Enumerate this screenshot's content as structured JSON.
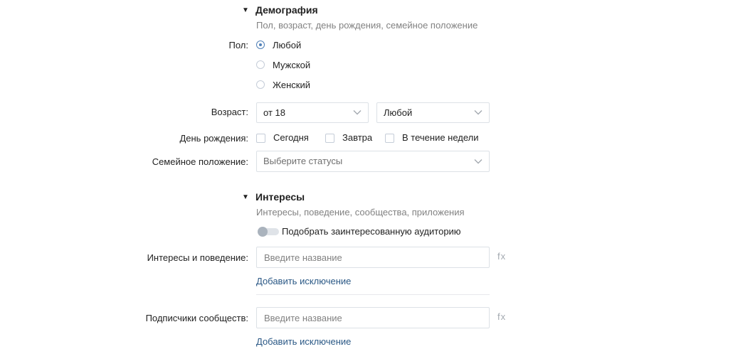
{
  "demography": {
    "title": "Демография",
    "subtitle": "Пол, возраст, день рождения, семейное положение",
    "sex": {
      "label": "Пол:",
      "options": [
        "Любой",
        "Мужской",
        "Женский"
      ],
      "selected": "Любой"
    },
    "age": {
      "label": "Возраст:",
      "from": "от 18",
      "to": "Любой"
    },
    "birthday": {
      "label": "День рождения:",
      "options": [
        "Сегодня",
        "Завтра",
        "В течение недели"
      ]
    },
    "marital": {
      "label": "Семейное положение:",
      "placeholder": "Выберите статусы"
    }
  },
  "interests": {
    "title": "Интересы",
    "subtitle": "Интересы, поведение, сообщества, приложения",
    "toggle_label": "Подобрать заинтересованную аудиторию",
    "interests_behavior": {
      "label": "Интересы и поведение:",
      "placeholder": "Введите название",
      "fx": "fx",
      "add_exclusion": "Добавить исключение"
    },
    "community_subscribers": {
      "label": "Подписчики сообществ:",
      "placeholder": "Введите название",
      "fx": "fx",
      "add_exclusion": "Добавить исключение"
    }
  },
  "colors": {
    "accent": "#5181b8",
    "link": "#2a5885",
    "muted": "#828282",
    "border": "#dce1e6"
  }
}
